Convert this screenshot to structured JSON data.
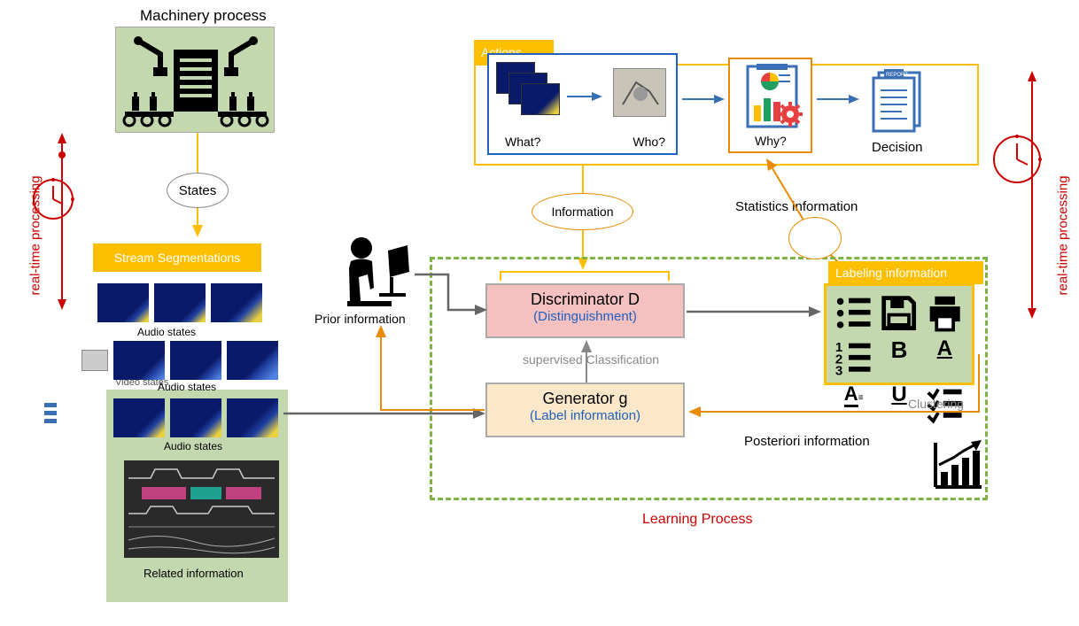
{
  "left_axis": {
    "label": "real-time processing"
  },
  "right_axis": {
    "label": "real-time processing"
  },
  "machinery": {
    "title": "Machinery process"
  },
  "states_label": "States",
  "stream_seg": {
    "title": "Stream Segmentations"
  },
  "audio_labels": {
    "row1": "Audio states",
    "row2": "Audio states",
    "row3": "Audio states"
  },
  "video_label": "Video states",
  "related_info": "Related information",
  "prior_info": "Prior information",
  "actions": {
    "header": "Actions",
    "what": "What?",
    "who": "Who?",
    "why": "Why?",
    "decision": "Decision"
  },
  "information_label": "Information",
  "stats_label": "Statistics information",
  "discriminator": {
    "title": "Discriminator D",
    "sub": "(Distinguishment)"
  },
  "generator": {
    "title": "Generator g",
    "sub": "(Label information)"
  },
  "supervised": "supervised Classification",
  "labeling": {
    "header": "Labeling information"
  },
  "clustering": "Clustering",
  "posteriori": "Posteriori information",
  "learning": "Learning Process"
}
